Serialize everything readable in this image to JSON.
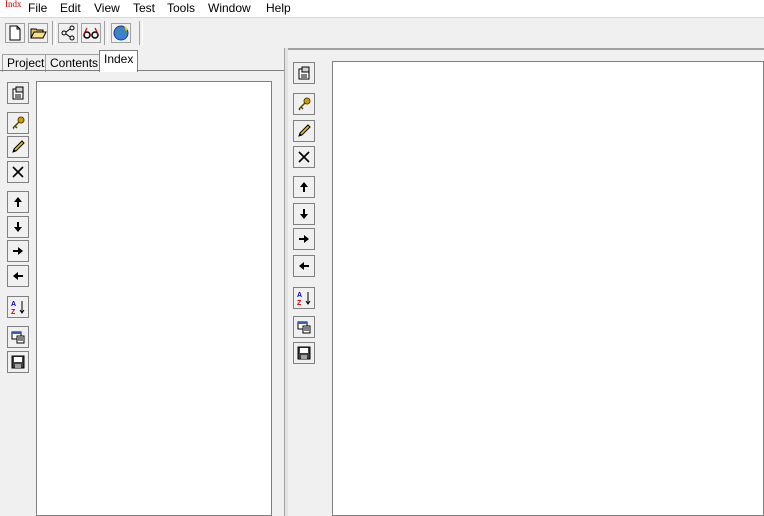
{
  "app_icon_text": "Indx",
  "menu": [
    "File",
    "Edit",
    "View",
    "Test",
    "Tools",
    "Window",
    "Help"
  ],
  "toolbar_icons": [
    "new-document-icon",
    "open-folder-icon",
    "share-icon",
    "glasses-icon",
    "globe-icon"
  ],
  "tabs": {
    "project": "Project",
    "contents": "Contents",
    "index": "Index",
    "active": "Index"
  },
  "side_icons": [
    "properties-icon",
    "key-icon",
    "pencil-icon",
    "delete-icon",
    "move-up-icon",
    "move-down-icon",
    "move-right-icon",
    "move-left-icon",
    "sort-az-icon",
    "window-list-icon",
    "save-icon"
  ],
  "colors": {
    "key": "#c8a000",
    "pencil": "#e8c000",
    "sort_az": "#0000c8"
  }
}
